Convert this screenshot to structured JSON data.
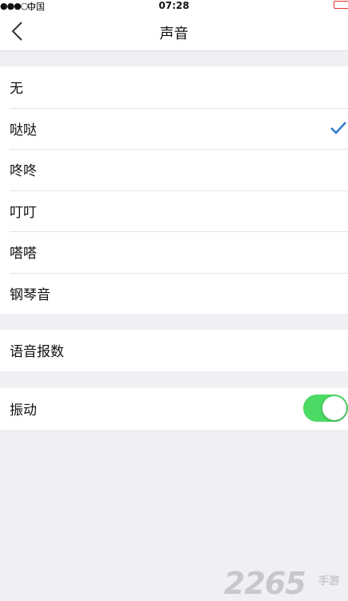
{
  "status_bar": {
    "signal": "●●●○○",
    "carrier": "中国",
    "time": "07:28"
  },
  "nav": {
    "title": "声音",
    "back_icon": "chevron-left-icon"
  },
  "sound_options": [
    {
      "label": "无",
      "selected": false
    },
    {
      "label": "哒哒",
      "selected": true
    },
    {
      "label": "咚咚",
      "selected": false
    },
    {
      "label": "叮叮",
      "selected": false
    },
    {
      "label": "嗒嗒",
      "selected": false
    },
    {
      "label": "钢琴音",
      "selected": false
    }
  ],
  "voice_readout": {
    "label": "语音报数"
  },
  "vibration": {
    "label": "振动",
    "on": true
  },
  "colors": {
    "accent": "#2e7ad1",
    "toggle_on": "#4cd964",
    "background": "#efeff4"
  },
  "watermark": {
    "number": "2265",
    "text": "手游"
  }
}
